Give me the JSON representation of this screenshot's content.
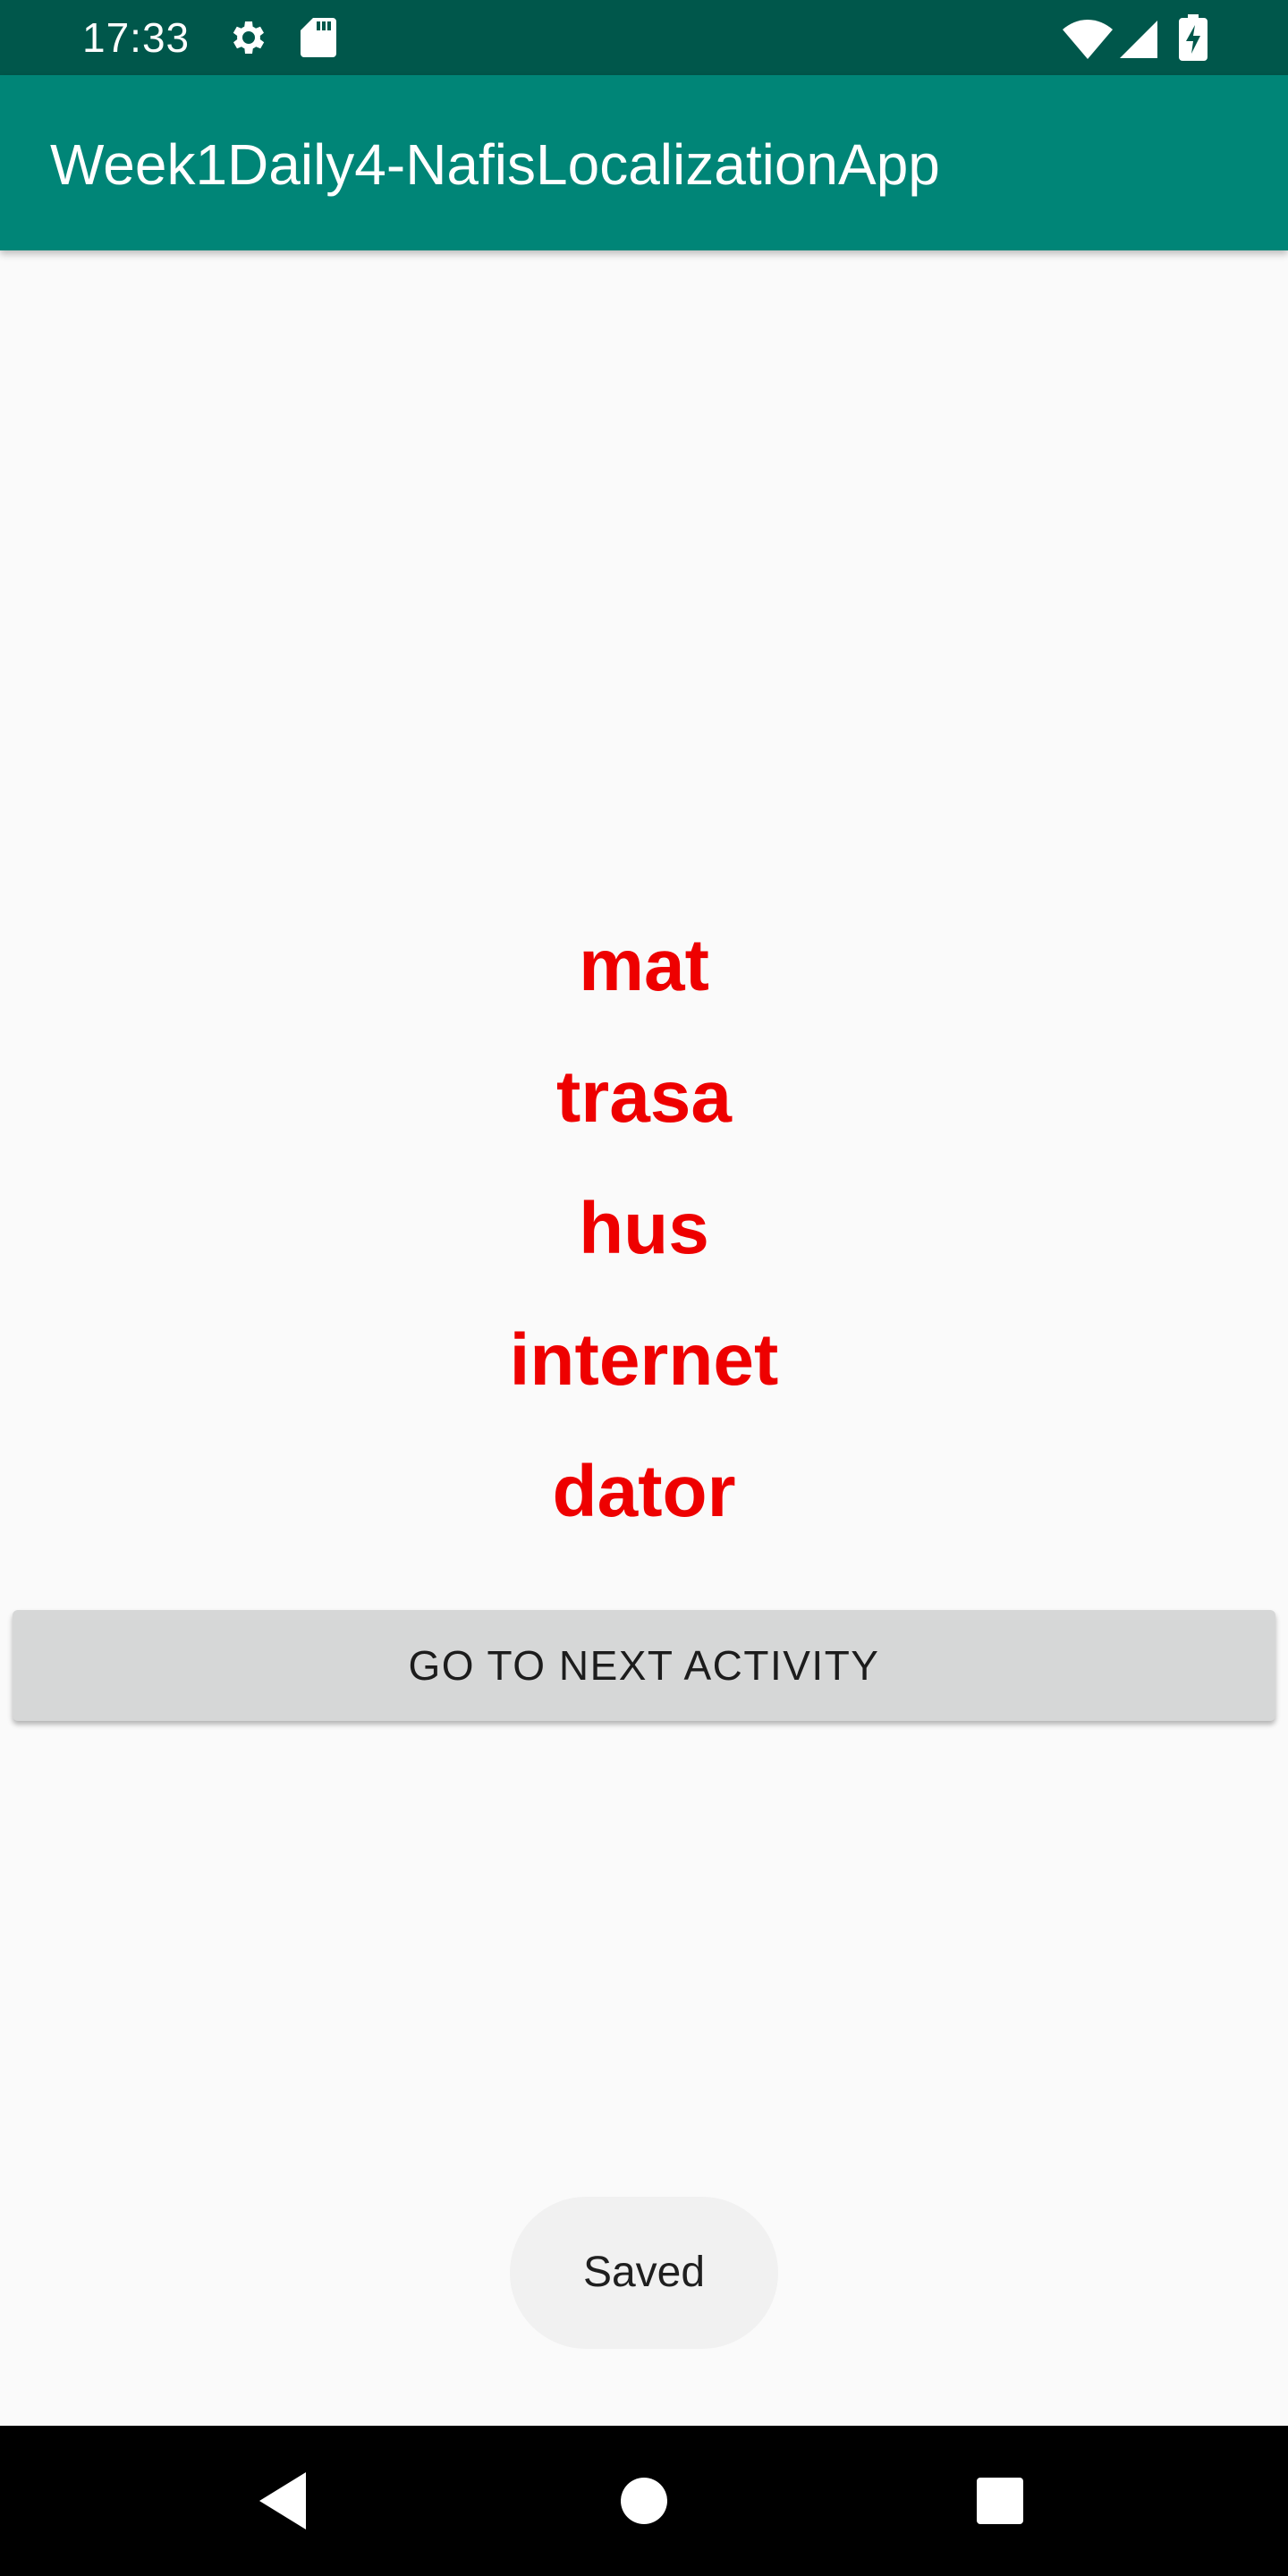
{
  "status_bar": {
    "time": "17:33",
    "icons": [
      "gear-icon",
      "sd-card-icon",
      "wifi-icon",
      "cell-signal-icon",
      "battery-charging-icon"
    ],
    "background": "#00574b"
  },
  "app_bar": {
    "title": "Week1Daily4-NafisLocalizationApp",
    "background": "#008577"
  },
  "content": {
    "words": [
      "mat",
      "trasa",
      "hus",
      "internet",
      "dator"
    ],
    "word_color": "#ee0000",
    "next_button_label": "GO TO NEXT ACTIVITY"
  },
  "toast": {
    "message": "Saved"
  },
  "nav_bar": {
    "buttons": [
      "back-icon",
      "home-icon",
      "recents-icon"
    ]
  }
}
